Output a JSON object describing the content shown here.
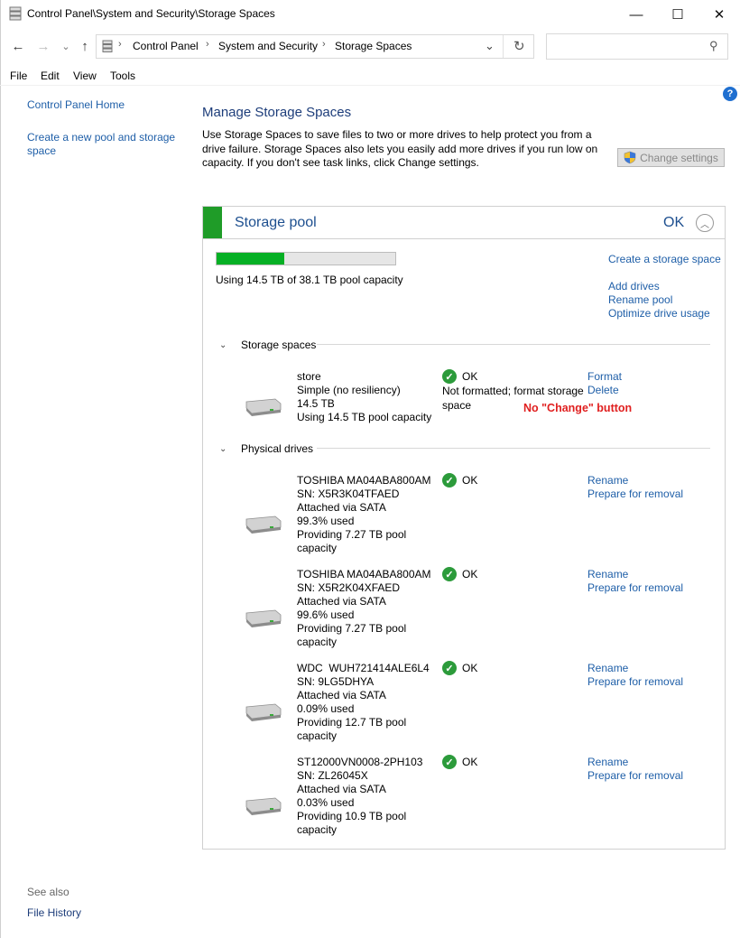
{
  "window": {
    "title": "Control Panel\\System and Security\\Storage Spaces",
    "minimize": "—",
    "maximize": "☐",
    "close": "✕"
  },
  "nav": {
    "back": "←",
    "forward": "→",
    "recent": "⌄",
    "up": "↑",
    "refresh": "↻",
    "breadcrumbs": [
      "Control Panel",
      "System and Security",
      "Storage Spaces"
    ],
    "separator": "›",
    "dropdown": "⌄",
    "search_placeholder": "",
    "search_icon": "⚲"
  },
  "menu": [
    "File",
    "Edit",
    "View",
    "Tools"
  ],
  "left_pane": {
    "home": "Control Panel Home",
    "create_pool": "Create a new pool and storage space",
    "see_also": "See also",
    "file_history": "File History"
  },
  "main": {
    "heading": "Manage Storage Spaces",
    "intro": "Use Storage Spaces to save files to two or more drives to help protect you from a drive failure. Storage Spaces also lets you easily add more drives if you run low on capacity. If you don't see task links, click Change settings.",
    "change_settings": "Change settings",
    "help": "?"
  },
  "pool": {
    "title": "Storage pool",
    "status": "OK",
    "collapse_glyph": "︿",
    "used_fraction": 0.381,
    "capacity_text": "Using 14.5 TB of 38.1 TB pool capacity",
    "links": {
      "create_space": "Create a storage space",
      "add_drives": "Add drives",
      "rename_pool": "Rename pool",
      "optimize": "Optimize drive usage"
    },
    "colors": {
      "accent": "#1f9c28",
      "fill": "#06b025",
      "link": "#1f5fa8"
    }
  },
  "spaces_section": {
    "label": "Storage spaces",
    "chevron": "⌄",
    "space": {
      "name": "store",
      "resiliency": "Simple (no resiliency)",
      "size": "14.5 TB",
      "usage": "Using 14.5 TB pool capacity",
      "status": "OK",
      "status_detail": "Not formatted; format storage space",
      "format": "Format",
      "delete": "Delete"
    },
    "annotation": "No \"Change\" button"
  },
  "drives_section": {
    "label": "Physical drives",
    "chevron": "⌄",
    "drives": [
      {
        "model": "TOSHIBA MA04ABA800AM",
        "sn": "SN: X5R3K04TFAED",
        "bus": "Attached via SATA",
        "used": "99.3% used",
        "providing": "Providing 7.27 TB pool capacity",
        "status": "OK",
        "rename": "Rename",
        "remove": "Prepare for removal"
      },
      {
        "model": "TOSHIBA MA04ABA800AM",
        "sn": "SN: X5R2K04XFAED",
        "bus": "Attached via SATA",
        "used": "99.6% used",
        "providing": "Providing 7.27 TB pool capacity",
        "status": "OK",
        "rename": "Rename",
        "remove": "Prepare for removal"
      },
      {
        "model": "WDC  WUH721414ALE6L4",
        "sn": "SN: 9LG5DHYA",
        "bus": "Attached via SATA",
        "used": "0.09% used",
        "providing": "Providing 12.7 TB pool capacity",
        "status": "OK",
        "rename": "Rename",
        "remove": "Prepare for removal"
      },
      {
        "model": "ST12000VN0008-2PH103",
        "sn": "SN: ZL26045X",
        "bus": "Attached via SATA",
        "used": "0.03% used",
        "providing": "Providing 10.9 TB pool capacity",
        "status": "OK",
        "rename": "Rename",
        "remove": "Prepare for removal"
      }
    ]
  }
}
